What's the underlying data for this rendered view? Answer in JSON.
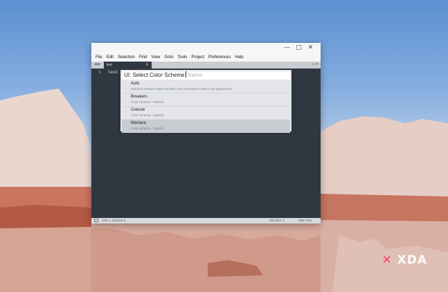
{
  "window": {
    "controls": {
      "minimize": "—",
      "maximize": "□",
      "close": "✕"
    },
    "menu": [
      "File",
      "Edit",
      "Selection",
      "Find",
      "View",
      "Goto",
      "Tools",
      "Project",
      "Preferences",
      "Help"
    ]
  },
  "tabs": {
    "nav": "◀ ▶",
    "active": {
      "label": "test",
      "close": "✕"
    },
    "tools": "+ ▾"
  },
  "editor": {
    "line_number": "1",
    "line_text": "test"
  },
  "palette": {
    "query": "UI: Select Color Scheme",
    "placeholder": "Name",
    "items": [
      {
        "name": "Auto",
        "desc": "Switches between light and dark color schemes to match OS appearance"
      },
      {
        "name": "Breakers",
        "desc": "Color Scheme - Default"
      },
      {
        "name": "Celeste",
        "desc": "Color Scheme - Default"
      },
      {
        "name": "Mariana",
        "desc": "Color Scheme - Default"
      }
    ],
    "selected_index": 3
  },
  "statusbar": {
    "position": "Line 1, Column 6",
    "tab_size": "Tab Size: 4",
    "syntax": "Plain Text"
  },
  "watermark": {
    "mark": "✕",
    "text": "XDA"
  }
}
